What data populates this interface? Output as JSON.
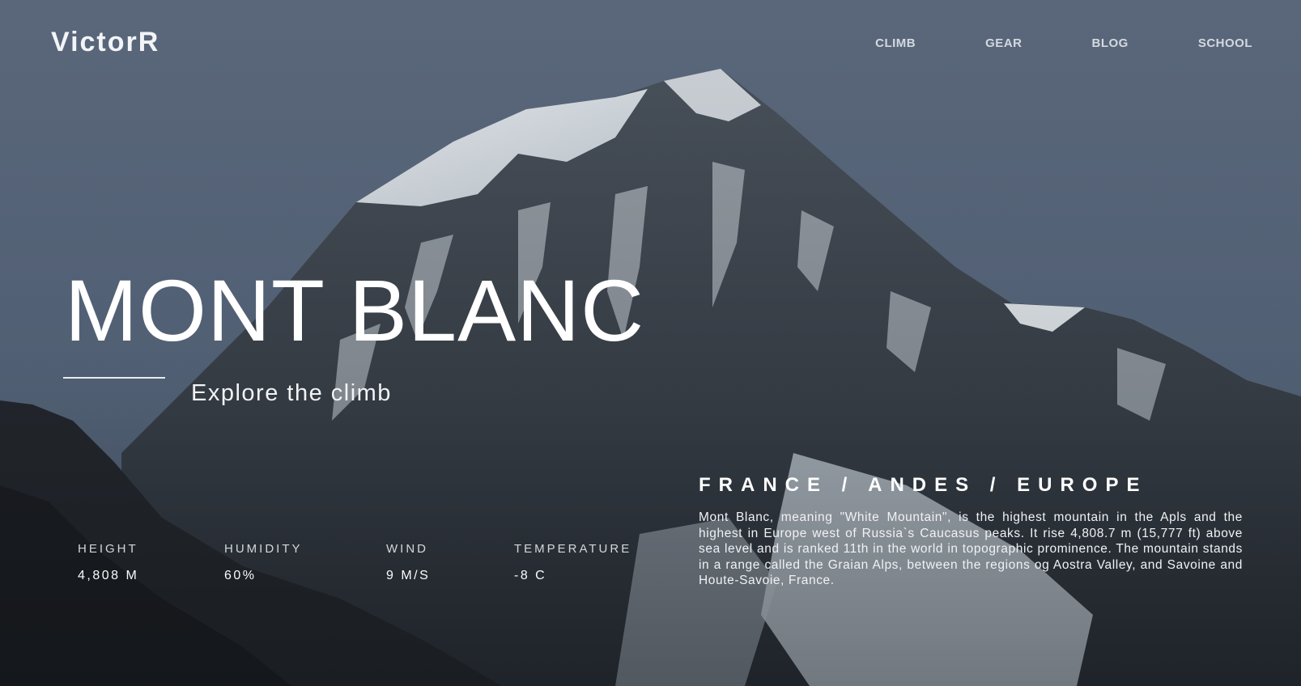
{
  "brand": {
    "logo": "VictorR"
  },
  "nav": {
    "items": [
      "CLIMB",
      "GEAR",
      "BLOG",
      "SCHOOL"
    ]
  },
  "hero": {
    "title": "MONT BLANC",
    "tagline": "Explore the climb"
  },
  "stats": [
    {
      "label": "HEIGHT",
      "value": "4,808 M"
    },
    {
      "label": "HUMIDITY",
      "value": "60%"
    },
    {
      "label": "WIND",
      "value": "9 M/S"
    },
    {
      "label": "TEMPERATURE",
      "value": "-8 C"
    }
  ],
  "info": {
    "location": "FRANCE / ANDES / EUROPE",
    "description": "Mont Blanc, meaning \"White Mountain\", is the highest mountain in the Apls and the highest in Europe west of Russia`s Caucasus peaks. It rise 4,808.7 m (15,777 ft) above sea level and is ranked 11th in the world in topographic prominence. The mountain stands in a range called the Graian Alps, between the regions og Aostra Valley, and Savoine and Houte-Savoie, France."
  },
  "colors": {
    "sky": "#5b697e",
    "rock": "#2e3338",
    "snow": "#dfe5ea",
    "text": "#ffffff"
  }
}
